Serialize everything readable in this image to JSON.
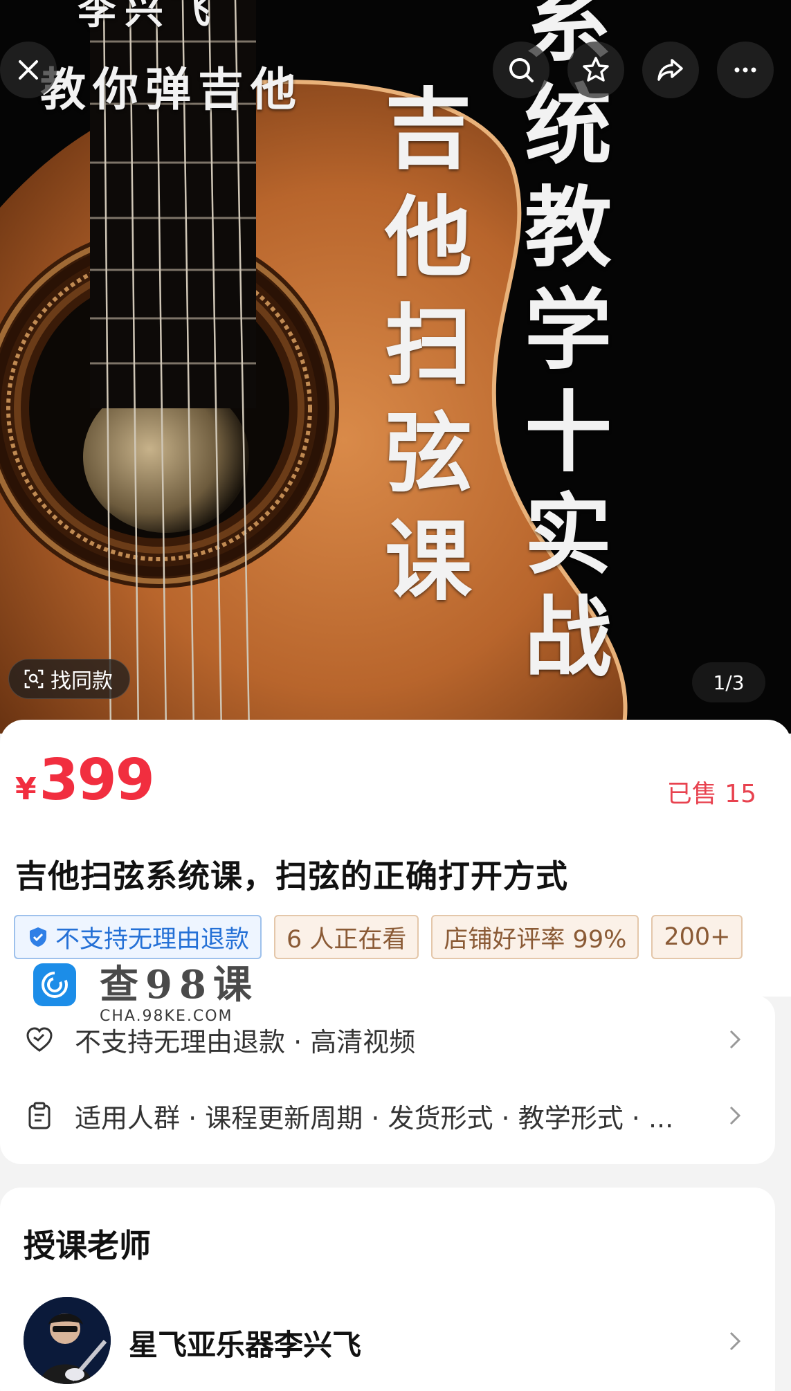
{
  "hero": {
    "cover_author": "李兴飞",
    "cover_tagline": "教你弹吉他",
    "cover_vertical_left": [
      "吉",
      "他",
      "扫",
      "弦",
      "课"
    ],
    "cover_vertical_right": [
      "系",
      "统",
      "教",
      "学",
      "十",
      "实",
      "战"
    ],
    "find_similar_label": "找同款",
    "page_indicator": "1/3"
  },
  "product": {
    "currency": "¥",
    "price": "399",
    "sold": "已售 15",
    "title": "吉他扫弦系统课，扫弦的正确打开方式",
    "tags": [
      "不支持无理由退款",
      "6 人正在看",
      "店铺好评率 99%",
      "200+"
    ]
  },
  "watermark": {
    "main": "查98课",
    "sub": "CHA.98KE.COM"
  },
  "services": {
    "row1": "不支持无理由退款 · 高清视频",
    "row2": "适用人群 · 课程更新周期 · 发货形式 · 教学形式 · ..."
  },
  "teacher": {
    "section_title": "授课老师",
    "name": "星飞亚乐器李兴飞"
  },
  "colors": {
    "price_red": "#f12e3f",
    "tag_border": "#e4c7aa",
    "tag_text": "#8a5a35",
    "refund_tag_blue": "#2470d6"
  }
}
